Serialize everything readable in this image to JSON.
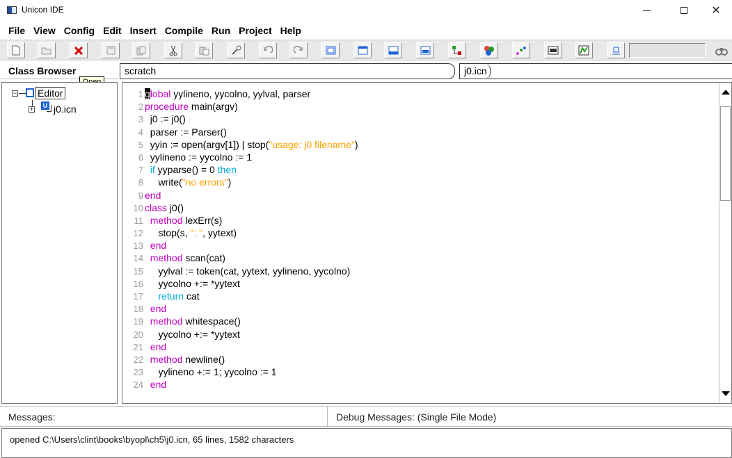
{
  "window": {
    "title": "Unicon IDE",
    "icon": "app-icon",
    "controls": {
      "minimize": "minimize-icon",
      "maximize": "maximize-icon",
      "close": "close-icon"
    }
  },
  "menu": [
    "File",
    "View",
    "Config",
    "Edit",
    "Insert",
    "Compile",
    "Run",
    "Project",
    "Help"
  ],
  "toolbar": {
    "buttons": [
      "new-file-icon",
      "open-folder-icon",
      "close-x-icon",
      "save-icon",
      "copy-doc-icon",
      "cut-icon",
      "paste-icon",
      "find-replace-icon",
      "undo-icon",
      "redo-icon",
      "layout-1-icon",
      "layout-2-icon",
      "layout-3-icon",
      "layout-4-icon",
      "compile-icon",
      "link-icon",
      "run-icon",
      "terminal-icon",
      "project-icon",
      "export-icon"
    ],
    "find_icon": "binoculars-icon"
  },
  "class_browser": {
    "label": "Class Browser",
    "tooltip": "Open",
    "tree": {
      "root_label": "Editor",
      "child_label": "j0.icn",
      "child_badge": "U"
    }
  },
  "tabs": {
    "scratch": "scratch",
    "file": "j0.icn"
  },
  "editor": {
    "lines": [
      {
        "n": "1",
        "segs": [
          [
            "cur",
            "g"
          ],
          [
            "kw",
            "lobal"
          ],
          [
            "",
            " yylineno, yycolno, yylval, parser"
          ]
        ]
      },
      {
        "n": "2",
        "segs": [
          [
            "kw",
            "procedure"
          ],
          [
            "",
            " main(argv)"
          ]
        ]
      },
      {
        "n": "3",
        "segs": [
          [
            "",
            "  j0 := j0()"
          ]
        ]
      },
      {
        "n": "4",
        "segs": [
          [
            "",
            "  parser := Parser()"
          ]
        ]
      },
      {
        "n": "5",
        "segs": [
          [
            "",
            "  yyin := open(argv[1]) | stop("
          ],
          [
            "str",
            "\"usage: j0 filename\""
          ],
          [
            "",
            ")"
          ]
        ]
      },
      {
        "n": "6",
        "segs": [
          [
            "",
            "  yylineno := yycolno := 1"
          ]
        ]
      },
      {
        "n": "7",
        "segs": [
          [
            "",
            "  "
          ],
          [
            "kw2",
            "if"
          ],
          [
            "",
            " yyparse() = 0 "
          ],
          [
            "kw2",
            "then"
          ]
        ]
      },
      {
        "n": "8",
        "segs": [
          [
            "",
            "     write("
          ],
          [
            "str",
            "\"no errors\""
          ],
          [
            "",
            ")"
          ]
        ]
      },
      {
        "n": "9",
        "segs": [
          [
            "kw",
            "end"
          ]
        ]
      },
      {
        "n": "10",
        "segs": [
          [
            "kw",
            "class"
          ],
          [
            "",
            " j0()"
          ]
        ]
      },
      {
        "n": "11",
        "segs": [
          [
            "",
            "  "
          ],
          [
            "kw",
            "method"
          ],
          [
            "",
            " lexErr(s)"
          ]
        ]
      },
      {
        "n": "12",
        "segs": [
          [
            "",
            "     stop(s, "
          ],
          [
            "str",
            "\": \""
          ],
          [
            "",
            ", yytext)"
          ]
        ]
      },
      {
        "n": "13",
        "segs": [
          [
            "",
            "  "
          ],
          [
            "kw",
            "end"
          ]
        ]
      },
      {
        "n": "14",
        "segs": [
          [
            "",
            "  "
          ],
          [
            "kw",
            "method"
          ],
          [
            "",
            " scan(cat)"
          ]
        ]
      },
      {
        "n": "15",
        "segs": [
          [
            "",
            "     yylval := token(cat, yytext, yylineno, yycolno)"
          ]
        ]
      },
      {
        "n": "16",
        "segs": [
          [
            "",
            "     yycolno +:= *yytext"
          ]
        ]
      },
      {
        "n": "17",
        "segs": [
          [
            "",
            "     "
          ],
          [
            "kw2",
            "return"
          ],
          [
            "",
            " cat"
          ]
        ]
      },
      {
        "n": "18",
        "segs": [
          [
            "",
            "  "
          ],
          [
            "kw",
            "end"
          ]
        ]
      },
      {
        "n": "19",
        "segs": [
          [
            "",
            "  "
          ],
          [
            "kw",
            "method"
          ],
          [
            "",
            " whitespace()"
          ]
        ]
      },
      {
        "n": "20",
        "segs": [
          [
            "",
            "     yycolno +:= *yytext"
          ]
        ]
      },
      {
        "n": "21",
        "segs": [
          [
            "",
            "  "
          ],
          [
            "kw",
            "end"
          ]
        ]
      },
      {
        "n": "22",
        "segs": [
          [
            "",
            "  "
          ],
          [
            "kw",
            "method"
          ],
          [
            "",
            " newline()"
          ]
        ]
      },
      {
        "n": "23",
        "segs": [
          [
            "",
            "     yylineno +:= 1; yycolno := 1"
          ]
        ]
      },
      {
        "n": "24",
        "segs": [
          [
            "",
            "  "
          ],
          [
            "kw",
            "end"
          ]
        ]
      }
    ]
  },
  "messages": {
    "label": "Messages:",
    "debug_label": "Debug Messages: (Single File Mode)",
    "text": "opened C:\\Users\\clint\\books\\byopl\\ch5\\j0.icn, 65 lines, 1582 characters"
  },
  "colors": {
    "keyword": "#c000c0",
    "control_keyword": "#00a8d8",
    "string": "#ffa000",
    "line_number": "#9a9a9a"
  }
}
